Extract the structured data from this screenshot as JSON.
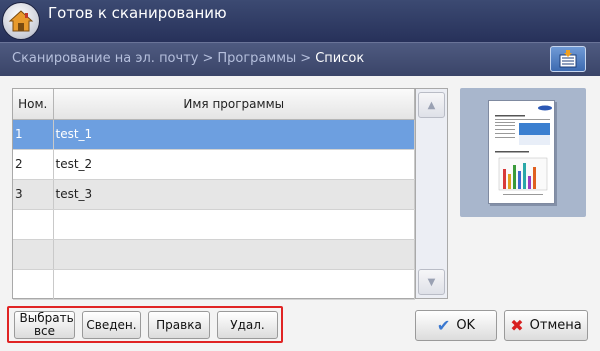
{
  "header": {
    "title": "Готов к сканированию"
  },
  "breadcrumb": {
    "items": [
      "Сканирование на эл. почту",
      "Программы"
    ],
    "current": "Список",
    "separator": ">"
  },
  "table": {
    "columns": [
      "Ном.",
      "Имя программы"
    ],
    "rows": [
      {
        "num": "1",
        "name": "test_1",
        "selected": true
      },
      {
        "num": "2",
        "name": "test_2",
        "selected": false
      },
      {
        "num": "3",
        "name": "test_3",
        "selected": false
      },
      {
        "num": "",
        "name": "",
        "selected": false
      },
      {
        "num": "",
        "name": "",
        "selected": false
      },
      {
        "num": "",
        "name": "",
        "selected": false
      }
    ]
  },
  "buttons": {
    "select_all": "Выбрать все",
    "details": "Сведен.",
    "edit": "Правка",
    "delete": "Удал.",
    "ok": "OK",
    "cancel": "Отмена"
  },
  "icons": {
    "home": "home-icon",
    "list_settings": "list-settings-icon",
    "scroll_up": "scroll-up-icon",
    "scroll_down": "scroll-down-icon",
    "ok": "checkmark-icon",
    "cancel": "close-x-icon"
  },
  "colors": {
    "accent_selected_row": "#6d9fe0",
    "top_bar": "#303b65",
    "ok_check": "#3a78d0",
    "cancel_x": "#d82020",
    "highlight_frame": "#e02424"
  }
}
